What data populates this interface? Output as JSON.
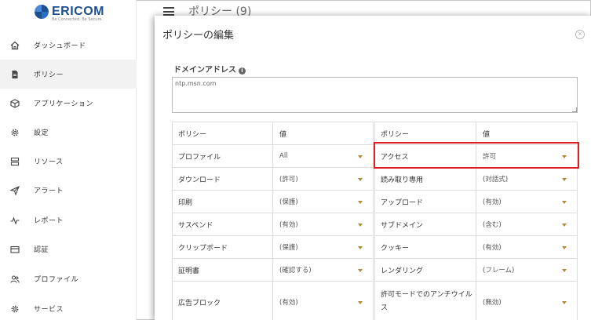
{
  "logo": {
    "name": "ERICOM",
    "tagline": "Be Connected. Be Secure."
  },
  "sidebar": {
    "items": [
      {
        "label": "ダッシュボード",
        "icon": "home-icon"
      },
      {
        "label": "ポリシー",
        "icon": "document-icon",
        "active": true
      },
      {
        "label": "アプリケーション",
        "icon": "cube-icon"
      },
      {
        "label": "設定",
        "icon": "gear-icon"
      },
      {
        "label": "リソース",
        "icon": "server-icon"
      },
      {
        "label": "アラート",
        "icon": "send-icon"
      },
      {
        "label": "レポート",
        "icon": "pulse-icon"
      },
      {
        "label": "認証",
        "icon": "card-icon"
      },
      {
        "label": "プロファイル",
        "icon": "users-icon"
      },
      {
        "label": "サービス",
        "icon": "gear-icon"
      }
    ]
  },
  "background": {
    "page_title": "ポリシー (9)"
  },
  "modal": {
    "title": "ポリシーの編集",
    "domain_label": "ドメインアドレス",
    "domain_value": "ntp.msn.com",
    "left_table": {
      "headers": [
        "ポリシー",
        "値"
      ],
      "rows": [
        {
          "name": "プロファイル",
          "value": "All"
        },
        {
          "name": "ダウンロード",
          "value": "(許可)"
        },
        {
          "name": "印刷",
          "value": "(保護)"
        },
        {
          "name": "サスペンド",
          "value": "(有効)"
        },
        {
          "name": "クリップボード",
          "value": "(保護)"
        },
        {
          "name": "証明書",
          "value": "(確認する)"
        },
        {
          "name": "広告ブロック",
          "value": "(有効)"
        }
      ]
    },
    "right_table": {
      "headers": [
        "ポリシー",
        "値"
      ],
      "rows": [
        {
          "name": "アクセス",
          "value": "許可"
        },
        {
          "name": "読み取り専用",
          "value": "(対話式)"
        },
        {
          "name": "アップロード",
          "value": "(有効)"
        },
        {
          "name": "サブドメイン",
          "value": "(含む)"
        },
        {
          "name": "クッキー",
          "value": "(有効)"
        },
        {
          "name": "レンダリング",
          "value": "(フレーム)"
        },
        {
          "name": "許可モードでのアンチウイルス",
          "value": "(無効)"
        }
      ]
    }
  },
  "colors": {
    "highlight": "#e02020",
    "caret": "#b08a3a",
    "logo": "#1d4f91"
  }
}
